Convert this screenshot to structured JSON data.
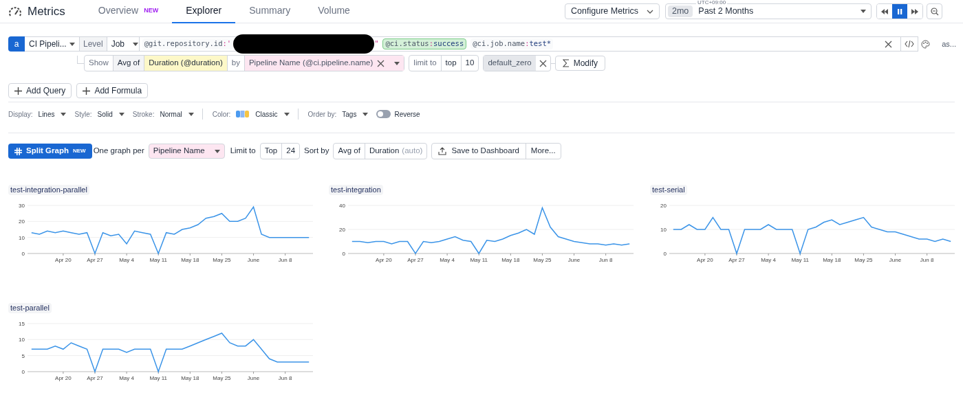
{
  "app": {
    "title": "Metrics"
  },
  "tabs": [
    {
      "label": "Overview",
      "badge": "NEW",
      "selected": false
    },
    {
      "label": "Explorer",
      "selected": true
    },
    {
      "label": "Summary",
      "selected": false
    },
    {
      "label": "Volume",
      "selected": false
    }
  ],
  "toolbar": {
    "configure": "Configure Metrics",
    "timezone": "UTC+09:00",
    "range_badge": "2mo",
    "range": "Past 2 Months",
    "playback": [
      {
        "kind": "rewind",
        "selected": false
      },
      {
        "kind": "pause",
        "selected": true
      },
      {
        "kind": "forward",
        "selected": false
      }
    ]
  },
  "query": {
    "letter": "a",
    "source": "CI Pipeli...",
    "level_label": "Level",
    "level": "Job",
    "filters": [
      {
        "key": "@git.repository.id",
        "separator": ":",
        "open_quote": "'",
        "redacted": true,
        "close_quote": "\"",
        "highlighted": false
      },
      {
        "key": "@ci.status",
        "separator": ":",
        "value": "success",
        "highlighted": true
      },
      {
        "key": "@ci.job.name",
        "separator": ":",
        "value": "test*",
        "highlighted": false
      }
    ],
    "alias": "as...",
    "show": "Show",
    "aggregation": "Avg of",
    "measure": "Duration (@duration)",
    "by": "by",
    "group": "Pipeline Name (@ci.pipeline.name)",
    "limit_label": "limit to",
    "limit_order": "top",
    "limit": "10",
    "fill": "default_zero",
    "modify": "Modify"
  },
  "add_buttons": [
    "Add Query",
    "Add Formula"
  ],
  "display_options": [
    {
      "kind": "select",
      "label": "Display:",
      "value": "Lines"
    },
    {
      "kind": "select",
      "label": "Style:",
      "value": "Solid"
    },
    {
      "kind": "select",
      "label": "Stroke:",
      "value": "Normal"
    },
    {
      "kind": "palette",
      "label": "Color:",
      "value": "Classic"
    },
    {
      "kind": "select",
      "label": "Order by:",
      "value": "Tags"
    },
    {
      "kind": "toggle",
      "value": "Reverse",
      "on": false
    }
  ],
  "split": {
    "button": "Split Graph",
    "badge": "NEW",
    "per_label": "One graph per",
    "per": "Pipeline Name",
    "limit_label": "Limit to",
    "limit_order": "Top",
    "limit": "24",
    "sort_label": "Sort by",
    "sort_agg": "Avg of",
    "sort_measure": "Duration",
    "sort_hint": "(auto)",
    "save": "Save to Dashboard",
    "more": "More..."
  },
  "graphs": [
    {
      "title": "test-integration-parallel",
      "chart_data": {
        "type": "line",
        "grid": true,
        "ylim": [
          0,
          30
        ],
        "yticks": [
          0,
          10,
          20,
          30
        ],
        "categories": [
          null,
          null,
          null,
          null,
          "Apr 20",
          null,
          null,
          null,
          "Apr 27",
          null,
          null,
          null,
          "May 4",
          null,
          null,
          null,
          "May 11",
          null,
          null,
          null,
          "May 18",
          null,
          null,
          null,
          "May 25",
          null,
          null,
          null,
          "June",
          null,
          null,
          null,
          "Jun 8",
          null,
          null,
          null
        ],
        "series": [
          {
            "color": "#3b94e8",
            "values": [
              13,
              12,
              14,
              13,
              14,
              13,
              12,
              13,
              0,
              13,
              11,
              12,
              6,
              14,
              13,
              12,
              0,
              13,
              12,
              15,
              16,
              18,
              22,
              23,
              25,
              20,
              20,
              22,
              29,
              12,
              10,
              10,
              10,
              10,
              10,
              10
            ]
          }
        ]
      }
    },
    {
      "title": "test-integration",
      "chart_data": {
        "type": "line",
        "grid": true,
        "ylim": [
          0,
          40
        ],
        "yticks": [
          0,
          20,
          40
        ],
        "categories": [
          null,
          null,
          null,
          null,
          "Apr 20",
          null,
          null,
          null,
          "Apr 27",
          null,
          null,
          null,
          "May 4",
          null,
          null,
          null,
          "May 11",
          null,
          null,
          null,
          "May 18",
          null,
          null,
          null,
          "May 25",
          null,
          null,
          null,
          "June",
          null,
          null,
          null,
          "Jun 8",
          null,
          null,
          null
        ],
        "series": [
          {
            "color": "#3b94e8",
            "values": [
              10,
              10,
              9,
              10,
              10,
              8,
              10,
              10,
              0,
              10,
              9,
              10,
              12,
              14,
              11,
              10,
              0,
              11,
              10,
              12,
              15,
              17,
              20,
              16,
              38,
              22,
              14,
              12,
              10,
              9,
              8,
              8,
              7,
              8,
              7,
              8
            ]
          }
        ]
      }
    },
    {
      "title": "test-serial",
      "chart_data": {
        "type": "line",
        "grid": true,
        "ylim": [
          0,
          20
        ],
        "yticks": [
          0,
          10,
          20
        ],
        "categories": [
          null,
          null,
          null,
          null,
          "Apr 20",
          null,
          null,
          null,
          "Apr 27",
          null,
          null,
          null,
          "May 4",
          null,
          null,
          null,
          "May 11",
          null,
          null,
          null,
          "May 18",
          null,
          null,
          null,
          "May 25",
          null,
          null,
          null,
          "June",
          null,
          null,
          null,
          "Jun 8",
          null,
          null,
          null
        ],
        "series": [
          {
            "color": "#3b94e8",
            "values": [
              10,
              10,
              12,
              10,
              10,
              15,
              10,
              10,
              0,
              10,
              10,
              10,
              12,
              10,
              10,
              10,
              0,
              10,
              11,
              13,
              14,
              12,
              13,
              14,
              15,
              11,
              10,
              9,
              9,
              8,
              7,
              6,
              6,
              5,
              6,
              5
            ]
          }
        ]
      }
    },
    {
      "title": "test-parallel",
      "chart_data": {
        "type": "line",
        "grid": true,
        "ylim": [
          0,
          15
        ],
        "yticks": [
          0,
          5,
          10,
          15
        ],
        "categories": [
          null,
          null,
          null,
          null,
          "Apr 20",
          null,
          null,
          null,
          "Apr 27",
          null,
          null,
          null,
          "May 4",
          null,
          null,
          null,
          "May 11",
          null,
          null,
          null,
          "May 18",
          null,
          null,
          null,
          "May 25",
          null,
          null,
          null,
          "June",
          null,
          null,
          null,
          "Jun 8",
          null,
          null,
          null
        ],
        "series": [
          {
            "color": "#3b94e8",
            "values": [
              7,
              7,
              7,
              8,
              7,
              9,
              8,
              7,
              0,
              7,
              7,
              7,
              6,
              7,
              7,
              7,
              0,
              7,
              7,
              7,
              8,
              9,
              10,
              11,
              12,
              9,
              8,
              8,
              10,
              7,
              4,
              3,
              3,
              3,
              3,
              3
            ]
          }
        ]
      }
    }
  ]
}
